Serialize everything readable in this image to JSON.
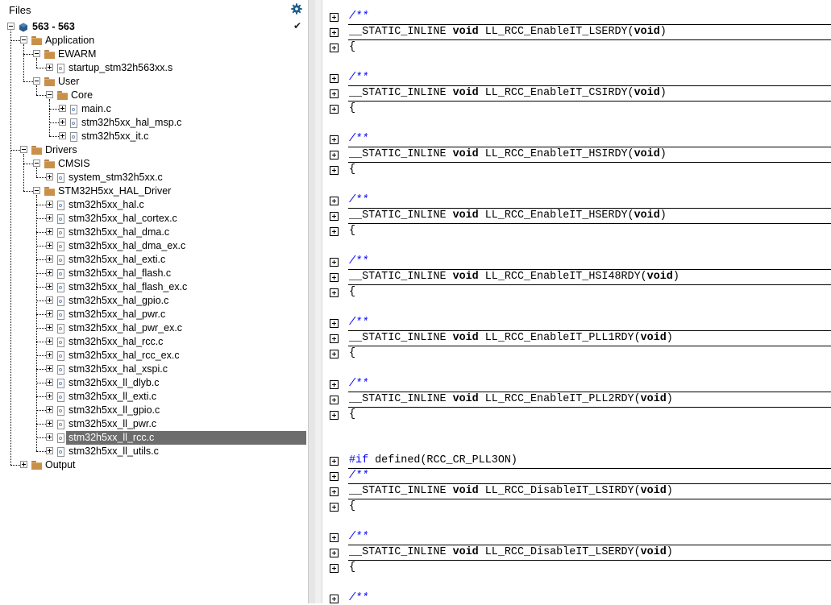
{
  "files_pane": {
    "title": "Files",
    "settings_icon": "gear-icon",
    "status_icon": "checkmark-icon",
    "tree": [
      {
        "label": "563 - 563",
        "type": "project",
        "depth": 0,
        "expanded": true,
        "bold": true
      },
      {
        "label": "Application",
        "type": "folder",
        "depth": 1,
        "expanded": true
      },
      {
        "label": "EWARM",
        "type": "folder",
        "depth": 2,
        "expanded": true
      },
      {
        "label": "startup_stm32h563xx.s",
        "type": "file",
        "depth": 3
      },
      {
        "label": "User",
        "type": "folder",
        "depth": 2,
        "expanded": true
      },
      {
        "label": "Core",
        "type": "folder",
        "depth": 3,
        "expanded": true
      },
      {
        "label": "main.c",
        "type": "file",
        "depth": 4
      },
      {
        "label": "stm32h5xx_hal_msp.c",
        "type": "file",
        "depth": 4
      },
      {
        "label": "stm32h5xx_it.c",
        "type": "file",
        "depth": 4
      },
      {
        "label": "Drivers",
        "type": "folder",
        "depth": 1,
        "expanded": true
      },
      {
        "label": "CMSIS",
        "type": "folder",
        "depth": 2,
        "expanded": true
      },
      {
        "label": "system_stm32h5xx.c",
        "type": "file",
        "depth": 3
      },
      {
        "label": "STM32H5xx_HAL_Driver",
        "type": "folder",
        "depth": 2,
        "expanded": true
      },
      {
        "label": "stm32h5xx_hal.c",
        "type": "file",
        "depth": 3
      },
      {
        "label": "stm32h5xx_hal_cortex.c",
        "type": "file",
        "depth": 3
      },
      {
        "label": "stm32h5xx_hal_dma.c",
        "type": "file",
        "depth": 3
      },
      {
        "label": "stm32h5xx_hal_dma_ex.c",
        "type": "file",
        "depth": 3
      },
      {
        "label": "stm32h5xx_hal_exti.c",
        "type": "file",
        "depth": 3
      },
      {
        "label": "stm32h5xx_hal_flash.c",
        "type": "file",
        "depth": 3
      },
      {
        "label": "stm32h5xx_hal_flash_ex.c",
        "type": "file",
        "depth": 3
      },
      {
        "label": "stm32h5xx_hal_gpio.c",
        "type": "file",
        "depth": 3
      },
      {
        "label": "stm32h5xx_hal_pwr.c",
        "type": "file",
        "depth": 3
      },
      {
        "label": "stm32h5xx_hal_pwr_ex.c",
        "type": "file",
        "depth": 3
      },
      {
        "label": "stm32h5xx_hal_rcc.c",
        "type": "file",
        "depth": 3
      },
      {
        "label": "stm32h5xx_hal_rcc_ex.c",
        "type": "file",
        "depth": 3
      },
      {
        "label": "stm32h5xx_hal_xspi.c",
        "type": "file",
        "depth": 3
      },
      {
        "label": "stm32h5xx_ll_dlyb.c",
        "type": "file",
        "depth": 3
      },
      {
        "label": "stm32h5xx_ll_exti.c",
        "type": "file",
        "depth": 3
      },
      {
        "label": "stm32h5xx_ll_gpio.c",
        "type": "file",
        "depth": 3
      },
      {
        "label": "stm32h5xx_ll_pwr.c",
        "type": "file",
        "depth": 3
      },
      {
        "label": "stm32h5xx_ll_rcc.c",
        "type": "file",
        "depth": 3,
        "selected": true
      },
      {
        "label": "stm32h5xx_ll_utils.c",
        "type": "file",
        "depth": 3
      },
      {
        "label": "Output",
        "type": "folder",
        "depth": 1,
        "expanded": false
      }
    ]
  },
  "editor": {
    "blocks": [
      {
        "kind": "func",
        "comment": "/**",
        "prefix": "__STATIC_INLINE ",
        "kw": "void",
        "name": " LL_RCC_EnableIT_LSERDY(",
        "kw2": "void",
        "suffix": ")",
        "brace": "{"
      },
      {
        "kind": "func",
        "comment": "/**",
        "prefix": "__STATIC_INLINE ",
        "kw": "void",
        "name": " LL_RCC_EnableIT_CSIRDY(",
        "kw2": "void",
        "suffix": ")",
        "brace": "{"
      },
      {
        "kind": "func",
        "comment": "/**",
        "prefix": "__STATIC_INLINE ",
        "kw": "void",
        "name": " LL_RCC_EnableIT_HSIRDY(",
        "kw2": "void",
        "suffix": ")",
        "brace": "{"
      },
      {
        "kind": "func",
        "comment": "/**",
        "prefix": "__STATIC_INLINE ",
        "kw": "void",
        "name": " LL_RCC_EnableIT_HSERDY(",
        "kw2": "void",
        "suffix": ")",
        "brace": "{"
      },
      {
        "kind": "func",
        "comment": "/**",
        "prefix": "__STATIC_INLINE ",
        "kw": "void",
        "name": " LL_RCC_EnableIT_HSI48RDY(",
        "kw2": "void",
        "suffix": ")",
        "brace": "{"
      },
      {
        "kind": "func",
        "comment": "/**",
        "prefix": "__STATIC_INLINE ",
        "kw": "void",
        "name": " LL_RCC_EnableIT_PLL1RDY(",
        "kw2": "void",
        "suffix": ")",
        "brace": "{"
      },
      {
        "kind": "func",
        "comment": "/**",
        "prefix": "__STATIC_INLINE ",
        "kw": "void",
        "name": " LL_RCC_EnableIT_PLL2RDY(",
        "kw2": "void",
        "suffix": ")",
        "brace": "{"
      },
      {
        "kind": "pp",
        "directive": "#if",
        "rest": " defined(RCC_CR_PLL3ON)"
      },
      {
        "kind": "func",
        "comment": "/**",
        "prefix": "__STATIC_INLINE ",
        "kw": "void",
        "name": " LL_RCC_DisableIT_LSIRDY(",
        "kw2": "void",
        "suffix": ")",
        "brace": "{"
      },
      {
        "kind": "func",
        "comment": "/**",
        "prefix": "__STATIC_INLINE ",
        "kw": "void",
        "name": " LL_RCC_DisableIT_LSERDY(",
        "kw2": "void",
        "suffix": ")",
        "brace": "{"
      },
      {
        "kind": "comment_only",
        "comment": "/**"
      }
    ]
  }
}
